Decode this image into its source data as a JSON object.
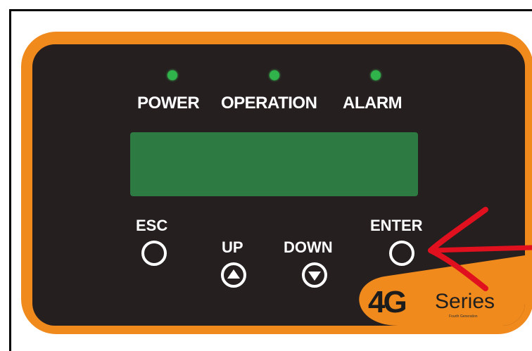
{
  "indicators": [
    {
      "label": "POWER",
      "color": "#2fb34a"
    },
    {
      "label": "OPERATION",
      "color": "#2fb34a"
    },
    {
      "label": "ALARM",
      "color": "#2fb34a"
    }
  ],
  "display": {
    "color": "#2d7a42"
  },
  "buttons": {
    "esc": "ESC",
    "up": "UP",
    "down": "DOWN",
    "enter": "ENTER"
  },
  "brand": {
    "model": "4G",
    "series": "Series",
    "tagline": "Fourth Generation"
  },
  "colors": {
    "panel": "#f08a1c",
    "face": "#261f1f",
    "annotation_arrow": "#e0101e"
  }
}
